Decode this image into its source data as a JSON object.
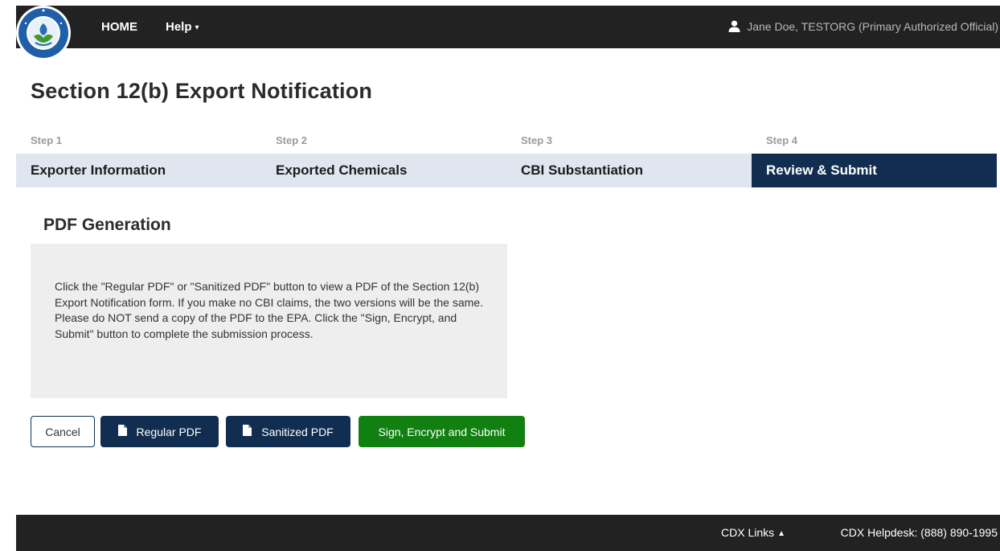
{
  "nav": {
    "home_label": "HOME",
    "help_label": "Help",
    "help_caret": "▲",
    "user_label": "Jane Doe, TESTORG (Primary Authorized Official)"
  },
  "page": {
    "title": "Section 12(b) Export Notification"
  },
  "steps": [
    {
      "number": "Step 1",
      "label": "Exporter Information",
      "active": false
    },
    {
      "number": "Step 2",
      "label": "Exported Chemicals",
      "active": false
    },
    {
      "number": "Step 3",
      "label": "CBI Substantiation",
      "active": false
    },
    {
      "number": "Step 4",
      "label": "Review & Submit",
      "active": true
    }
  ],
  "pdf_section": {
    "title": "PDF Generation",
    "instructions": "Click the \"Regular PDF\" or \"Sanitized PDF\" button to view a PDF of the Section 12(b) Export Notification form. If you make no CBI claims, the two versions will be the same. Please do NOT send a copy of the PDF to the EPA. Click the \"Sign, Encrypt, and Submit\" button to complete the submission process."
  },
  "buttons": {
    "cancel": "Cancel",
    "regular_pdf": "Regular PDF",
    "sanitized_pdf": "Sanitized PDF",
    "submit": "Sign, Encrypt and Submit"
  },
  "footer": {
    "links_label": "CDX Links",
    "links_caret": "▲",
    "helpdesk": "CDX Helpdesk: (888) 890-1995"
  },
  "colors": {
    "nav_background": "#222222",
    "step_inactive": "#dfe6f0",
    "step_active": "#112e51",
    "primary_button": "#112e51",
    "submit_button": "#118011"
  },
  "icons": {
    "logo": "epa-seal-logo",
    "user": "user-icon",
    "pdf": "document-icon"
  }
}
